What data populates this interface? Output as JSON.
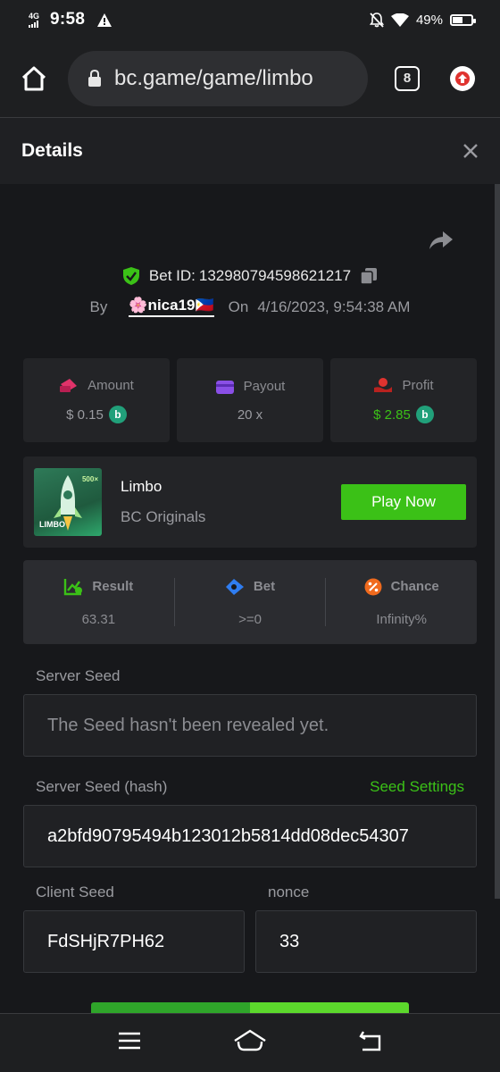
{
  "status_bar": {
    "network": "4G",
    "time": "9:58",
    "battery_percent": "49%",
    "battery_level": 0.49
  },
  "browser": {
    "url": "bc.game/game/limbo",
    "tab_count": "8"
  },
  "details": {
    "title": "Details",
    "bet_id_label": "Bet ID:",
    "bet_id": "132980794598621217",
    "by_label": "By",
    "username": "🌸nica19🇵🇭",
    "on_label": "On",
    "timestamp": "4/16/2023, 9:54:38 AM"
  },
  "stats": {
    "amount_label": "Amount",
    "amount_value": "$ 0.15",
    "payout_label": "Payout",
    "payout_value": "20 x",
    "profit_label": "Profit",
    "profit_value": "$ 2.85"
  },
  "game": {
    "name": "Limbo",
    "provider": "BC Originals",
    "play_label": "Play Now",
    "thumb_badge": "500×",
    "thumb_name": "LIMBO"
  },
  "result": {
    "result_label": "Result",
    "result_value": "63.31",
    "bet_label": "Bet",
    "bet_value": ">=0",
    "chance_label": "Chance",
    "chance_value": "Infinity%"
  },
  "seeds": {
    "server_seed_label": "Server Seed",
    "server_seed_value": "The Seed hasn't been revealed yet.",
    "server_hash_label": "Server Seed (hash)",
    "seed_settings_label": "Seed Settings",
    "server_hash_value": "a2bfd90795494b123012b5814dd08dec54307",
    "client_seed_label": "Client Seed",
    "client_seed_value": "FdSHjR7PH62",
    "nonce_label": "nonce",
    "nonce_value": "33"
  },
  "colors": {
    "accent_green": "#3bc117",
    "coin_green": "#21a07a",
    "amount_pink": "#e0336a",
    "payout_purple": "#8a4fe6",
    "profit_red": "#e0332f",
    "bet_blue": "#2f7df0",
    "chance_orange": "#f06a1d"
  }
}
